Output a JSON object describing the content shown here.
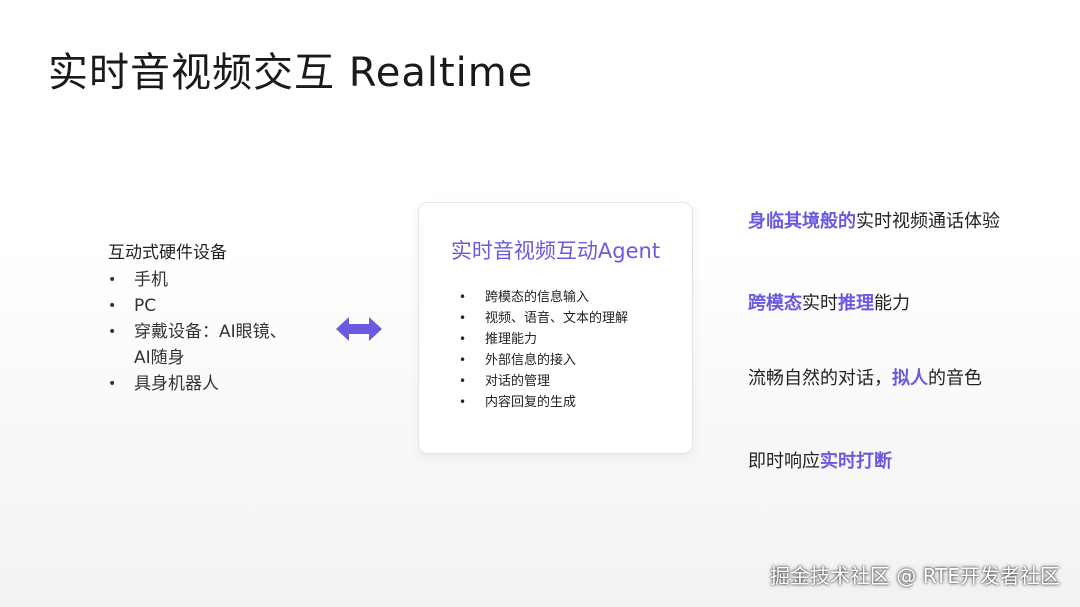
{
  "title": "实时音视频交互 Realtime",
  "hardware": {
    "heading": "互动式硬件设备",
    "items": [
      "手机",
      "PC",
      "穿戴设备：AI眼镜、",
      "AI随身",
      "具身机器人"
    ]
  },
  "agent": {
    "title": "实时音视频互动Agent",
    "items": [
      "跨模态的信息输入",
      "视频、语音、文本的理解",
      "推理能力",
      "外部信息的接入",
      "对话的管理",
      "内容回复的生成"
    ]
  },
  "features": {
    "f1": {
      "highlight": "身临其境般的",
      "text": "实时视频通话体验"
    },
    "f2": {
      "highlight1": "跨模态",
      "mid": "实时",
      "highlight2": "推理",
      "tail": "能力"
    },
    "f3": {
      "text": "流畅自然的对话，",
      "highlight": "拟人",
      "tail": "的音色"
    },
    "f4": {
      "text": "即时响应",
      "highlight": "实时打断"
    }
  },
  "watermark": "掘金技术社区 @ RTE开发者社区",
  "colors": {
    "accent": "#6a5ae0",
    "arrow": "#6a5ae0"
  },
  "icons": {
    "connector": "double-arrow-icon"
  }
}
